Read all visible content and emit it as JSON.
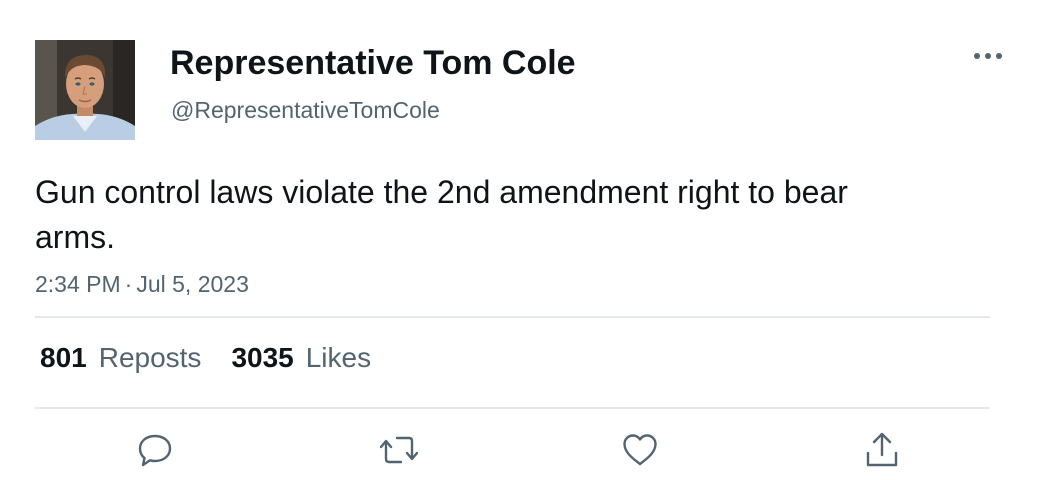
{
  "author": {
    "display_name": "Representative Tom Cole",
    "handle": "@RepresentativeTomCole",
    "avatar_icon": "profile-photo"
  },
  "tweet": {
    "text": "Gun control laws violate the 2nd amendment right to bear arms.",
    "time": "2:34 PM",
    "separator": "·",
    "date": "Jul 5, 2023"
  },
  "stats": {
    "reposts_count": "801",
    "reposts_label": "Reposts",
    "likes_count": "3035",
    "likes_label": "Likes"
  },
  "actions": {
    "reply_icon": "reply-icon",
    "repost_icon": "repost-icon",
    "like_icon": "heart-icon",
    "share_icon": "share-icon",
    "more_icon": "more-icon"
  },
  "colors": {
    "text_primary": "#0f1419",
    "text_secondary": "#536471",
    "divider": "#e4e8eb",
    "icon": "#536471"
  }
}
